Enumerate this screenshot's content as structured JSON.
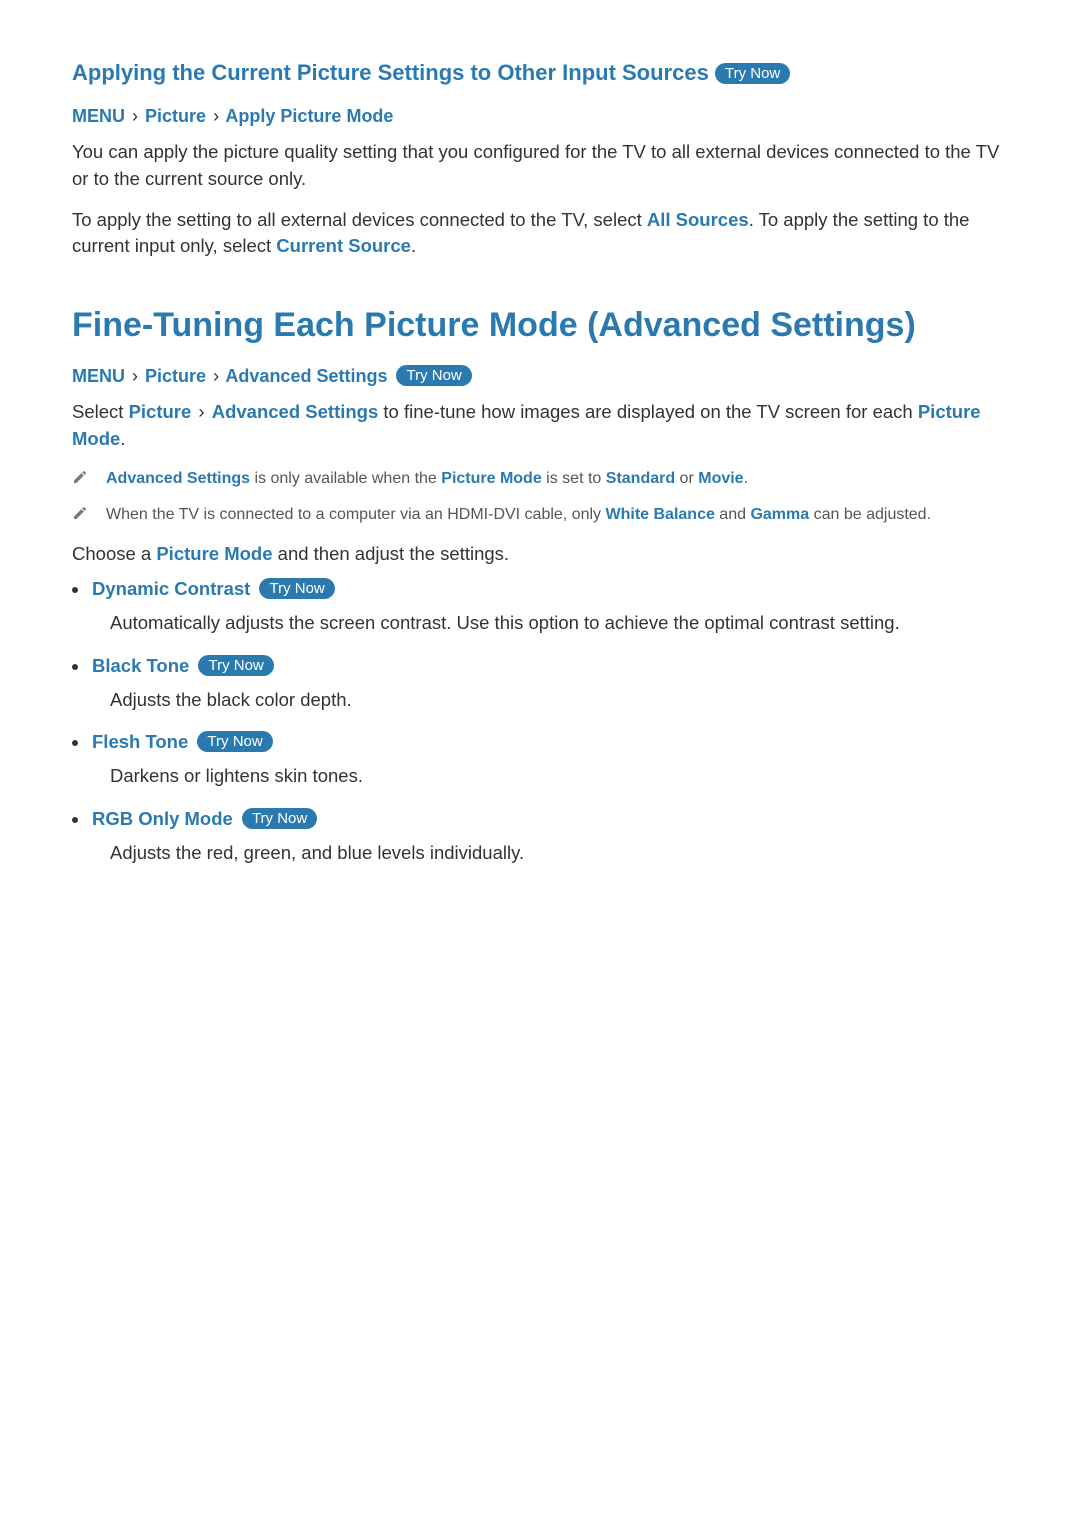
{
  "tryNow": "Try Now",
  "section1": {
    "title": "Applying the Current Picture Settings to Other Input Sources",
    "crumb": {
      "menu": "MENU",
      "pic": "Picture",
      "mode": "Apply Picture Mode"
    },
    "p1": "You can apply the picture quality setting that you configured for the TV to all external devices connected to the TV or to the current source only.",
    "p2a": "To apply the setting to all external devices connected to the TV, select ",
    "p2b": "All Sources",
    "p2c": ". To apply the setting to the current input only, select ",
    "p2d": "Current Source",
    "p2e": "."
  },
  "section2": {
    "title": "Fine-Tuning Each Picture Mode (Advanced Settings)",
    "crumb": {
      "menu": "MENU",
      "pic": "Picture",
      "adv": "Advanced Settings"
    },
    "introA": "Select ",
    "introB": "Picture",
    "introC": "Advanced Settings",
    "introD": " to fine-tune how images are displayed on the TV screen for each ",
    "introE": "Picture Mode",
    "introF": ".",
    "notes": [
      {
        "parts": [
          {
            "t": "Advanced Settings",
            "b": true
          },
          {
            "t": " is only available when the "
          },
          {
            "t": "Picture Mode",
            "b": true
          },
          {
            "t": " is set to "
          },
          {
            "t": "Standard",
            "b": true
          },
          {
            "t": " or "
          },
          {
            "t": "Movie",
            "b": true
          },
          {
            "t": "."
          }
        ]
      },
      {
        "parts": [
          {
            "t": "When the TV is connected to a computer via an HDMI-DVI cable, only "
          },
          {
            "t": "White Balance",
            "b": true
          },
          {
            "t": " and "
          },
          {
            "t": "Gamma",
            "b": true
          },
          {
            "t": " can be adjusted."
          }
        ]
      }
    ],
    "chooseA": "Choose a ",
    "chooseB": "Picture Mode",
    "chooseC": " and then adjust the settings.",
    "features": [
      {
        "name": "Dynamic Contrast",
        "desc": "Automatically adjusts the screen contrast. Use this option to achieve the optimal contrast setting."
      },
      {
        "name": "Black Tone",
        "desc": "Adjusts the black color depth."
      },
      {
        "name": "Flesh Tone",
        "desc": "Darkens or lightens skin tones."
      },
      {
        "name": "RGB Only Mode",
        "desc": "Adjusts the red, green, and blue levels individually."
      }
    ]
  }
}
